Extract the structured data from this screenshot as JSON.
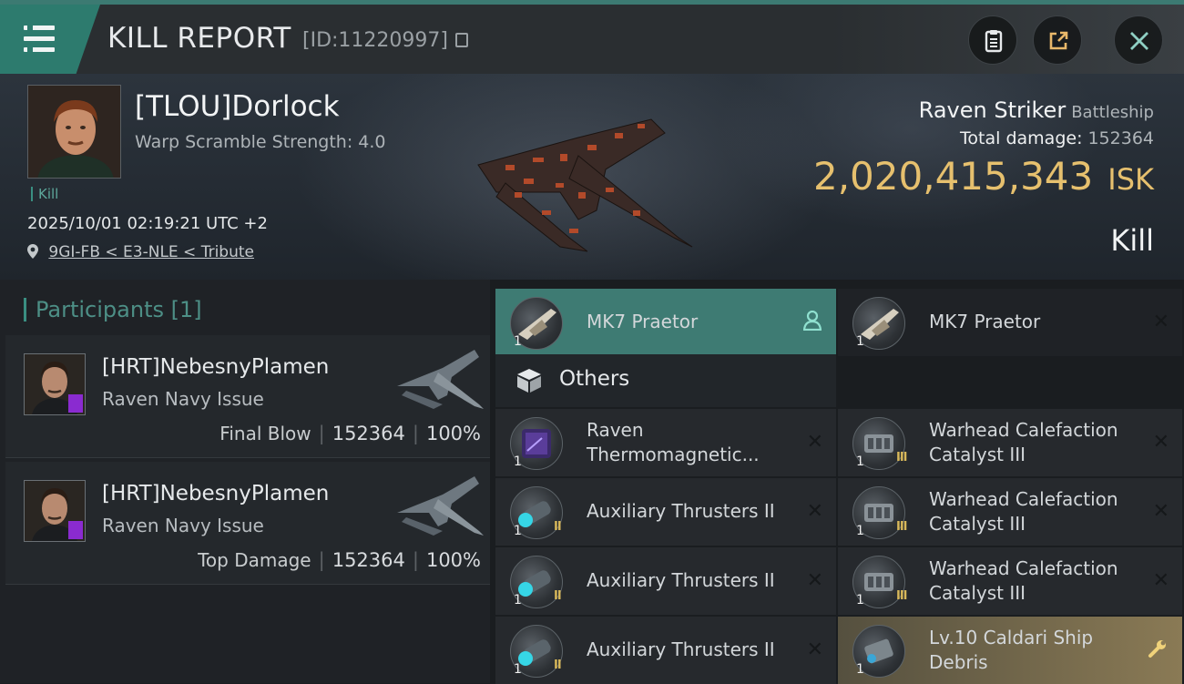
{
  "header": {
    "title": "KILL REPORT",
    "report_id": "[ID:11220997]",
    "icons": [
      "menu-icon",
      "copy-icon",
      "clipboard-icon",
      "share-icon",
      "close-icon"
    ]
  },
  "victim": {
    "name": "[TLOU]Dorlock",
    "warp_scramble": "Warp Scramble Strength: 4.0",
    "kill_tag": "Kill",
    "datetime": "2025/10/01 02:19:21 UTC +2",
    "location": "9GI-FB < E3-NLE < Tribute",
    "ship_name": "Raven Striker",
    "ship_class": "Battleship",
    "total_damage_label": "Total damage:",
    "total_damage_value": "152364",
    "isk_value": "2,020,415,343",
    "isk_unit": "ISK",
    "result": "Kill"
  },
  "participants": {
    "header": "Participants [1]",
    "list": [
      {
        "name": "[HRT]NebesnyPlamen",
        "ship": "Raven Navy Issue",
        "label": "Final Blow",
        "damage": "152364",
        "percent": "100%"
      },
      {
        "name": "[HRT]NebesnyPlamen",
        "ship": "Raven Navy Issue",
        "label": "Top Damage",
        "damage": "152364",
        "percent": "100%"
      }
    ]
  },
  "items": {
    "others_label": "Others",
    "top_left": {
      "name": "MK7  Praetor",
      "qty": "1"
    },
    "top_right": {
      "name": "MK7  Praetor",
      "qty": "1"
    },
    "left": [
      {
        "name_line1": "Raven",
        "name_line2": "Thermomagnetic...",
        "qty": "1",
        "tier": ""
      },
      {
        "name_line1": "Auxiliary Thrusters II",
        "qty": "1",
        "tier": "II"
      },
      {
        "name_line1": "Auxiliary Thrusters II",
        "qty": "1",
        "tier": "II"
      },
      {
        "name_line1": "Auxiliary Thrusters II",
        "qty": "1",
        "tier": "II"
      }
    ],
    "right": [
      {
        "name_line1": "Warhead Calefaction",
        "name_line2": "Catalyst III",
        "qty": "1",
        "tier": "III"
      },
      {
        "name_line1": "Warhead Calefaction",
        "name_line2": "Catalyst III",
        "qty": "1",
        "tier": "III"
      },
      {
        "name_line1": "Warhead Calefaction",
        "name_line2": "Catalyst III",
        "qty": "1",
        "tier": "III"
      },
      {
        "name_line1": "Lv.10 Caldari Ship",
        "name_line2": "Debris",
        "qty": "1",
        "tier": ""
      }
    ]
  },
  "colors": {
    "accent": "#3e7b73",
    "isk_gold": "#e6c06e",
    "panel": "#26292d",
    "debris_gold": "#8a7a55"
  }
}
